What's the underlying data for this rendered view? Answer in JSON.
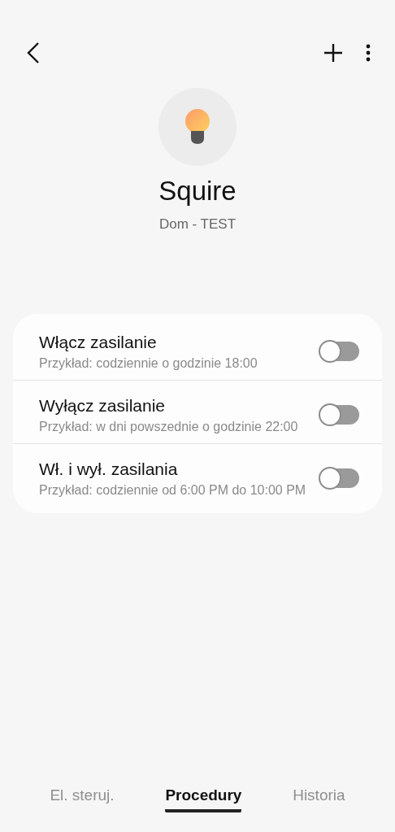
{
  "device": {
    "name": "Squire",
    "location": "Dom - TEST"
  },
  "routines": [
    {
      "title": "Włącz zasilanie",
      "example": "Przykład: codziennie o godzinie 18:00",
      "on": false
    },
    {
      "title": "Wyłącz zasilanie",
      "example": "Przykład: w dni powszednie o godzinie 22:00",
      "on": false
    },
    {
      "title": "Wł. i wył. zasilania",
      "example": "Przykład: codziennie od 6:00 PM do 10:00 PM",
      "on": false
    }
  ],
  "tabs": [
    {
      "label": "El. steruj.",
      "selected": false
    },
    {
      "label": "Procedury",
      "selected": true
    },
    {
      "label": "Historia",
      "selected": false
    }
  ]
}
